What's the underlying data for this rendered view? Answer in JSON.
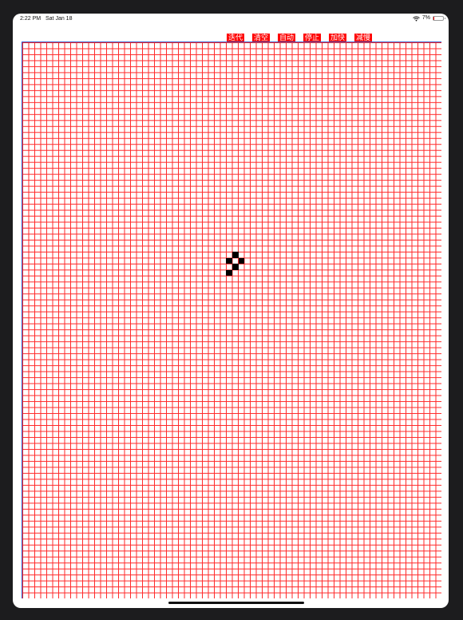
{
  "status": {
    "time": "2:22 PM",
    "date": "Sat Jan 18",
    "battery_percent_label": "7%",
    "battery_level": 0.07,
    "wifi_icon": "wifi-icon",
    "battery_icon": "battery-low-icon"
  },
  "toolbar": {
    "buttons": [
      {
        "id": "step",
        "label": "迭代"
      },
      {
        "id": "clear",
        "label": "清空"
      },
      {
        "id": "auto",
        "label": "自动"
      },
      {
        "id": "stop",
        "label": "停止"
      },
      {
        "id": "faster",
        "label": "加快"
      },
      {
        "id": "slower",
        "label": "减慢"
      }
    ]
  },
  "grid": {
    "columns": 70,
    "rows": 93,
    "line_color": "#ff2a2a",
    "border_color": "#2a57c9",
    "alive_color": "#000000",
    "alive_cells": [
      [
        35,
        35
      ],
      [
        34,
        36
      ],
      [
        36,
        36
      ],
      [
        35,
        37
      ],
      [
        34,
        38
      ]
    ]
  }
}
